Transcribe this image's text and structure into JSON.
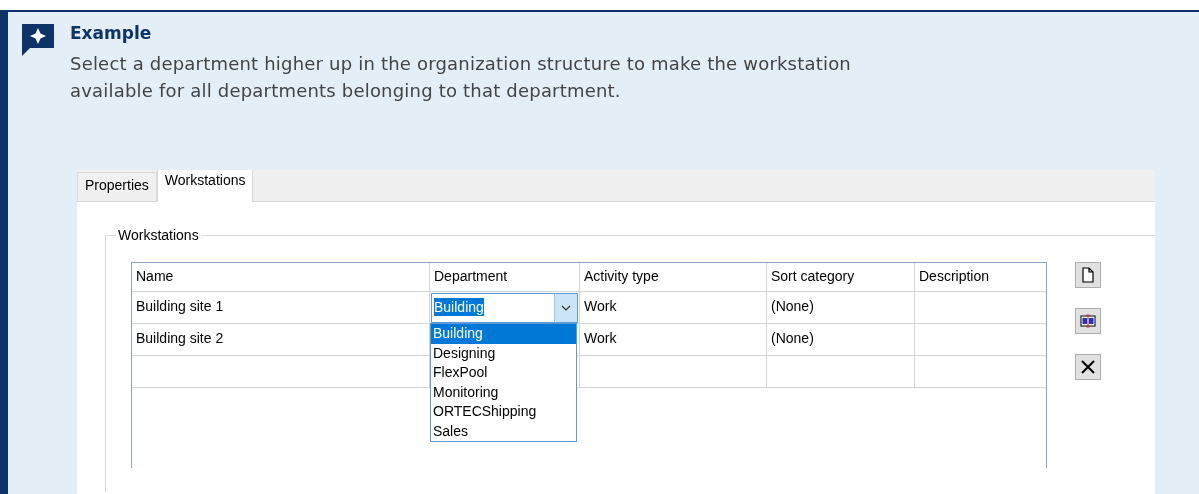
{
  "callout": {
    "title": "Example",
    "text": "Select a department higher up in the organization structure to make the workstation available for all departments belonging to that department."
  },
  "dialog": {
    "tabs": [
      {
        "label": "Properties",
        "selected": false
      },
      {
        "label": "Workstations",
        "selected": true
      }
    ],
    "group_title": "Workstations",
    "table": {
      "columns": [
        "Name",
        "Department",
        "Activity type",
        "Sort category",
        "Description"
      ],
      "rows": [
        {
          "cells": [
            "Building site 1",
            null,
            "Work",
            "(None)",
            null
          ],
          "combo": {
            "value": "Building",
            "items": [
              {
                "label": "Building",
                "selected": true
              },
              {
                "label": "Designing",
                "selected": false
              },
              {
                "label": "FlexPool",
                "selected": false
              },
              {
                "label": "Monitoring",
                "selected": false
              },
              {
                "label": "ORTECShipping",
                "selected": false
              },
              {
                "label": "Sales",
                "selected": false
              }
            ]
          }
        },
        {
          "cells": [
            "Building site 2",
            null,
            "Work",
            "(None)",
            null
          ]
        }
      ]
    },
    "tools": [
      {
        "kind": "new"
      },
      {
        "kind": "rename"
      },
      {
        "kind": "delete"
      }
    ]
  }
}
